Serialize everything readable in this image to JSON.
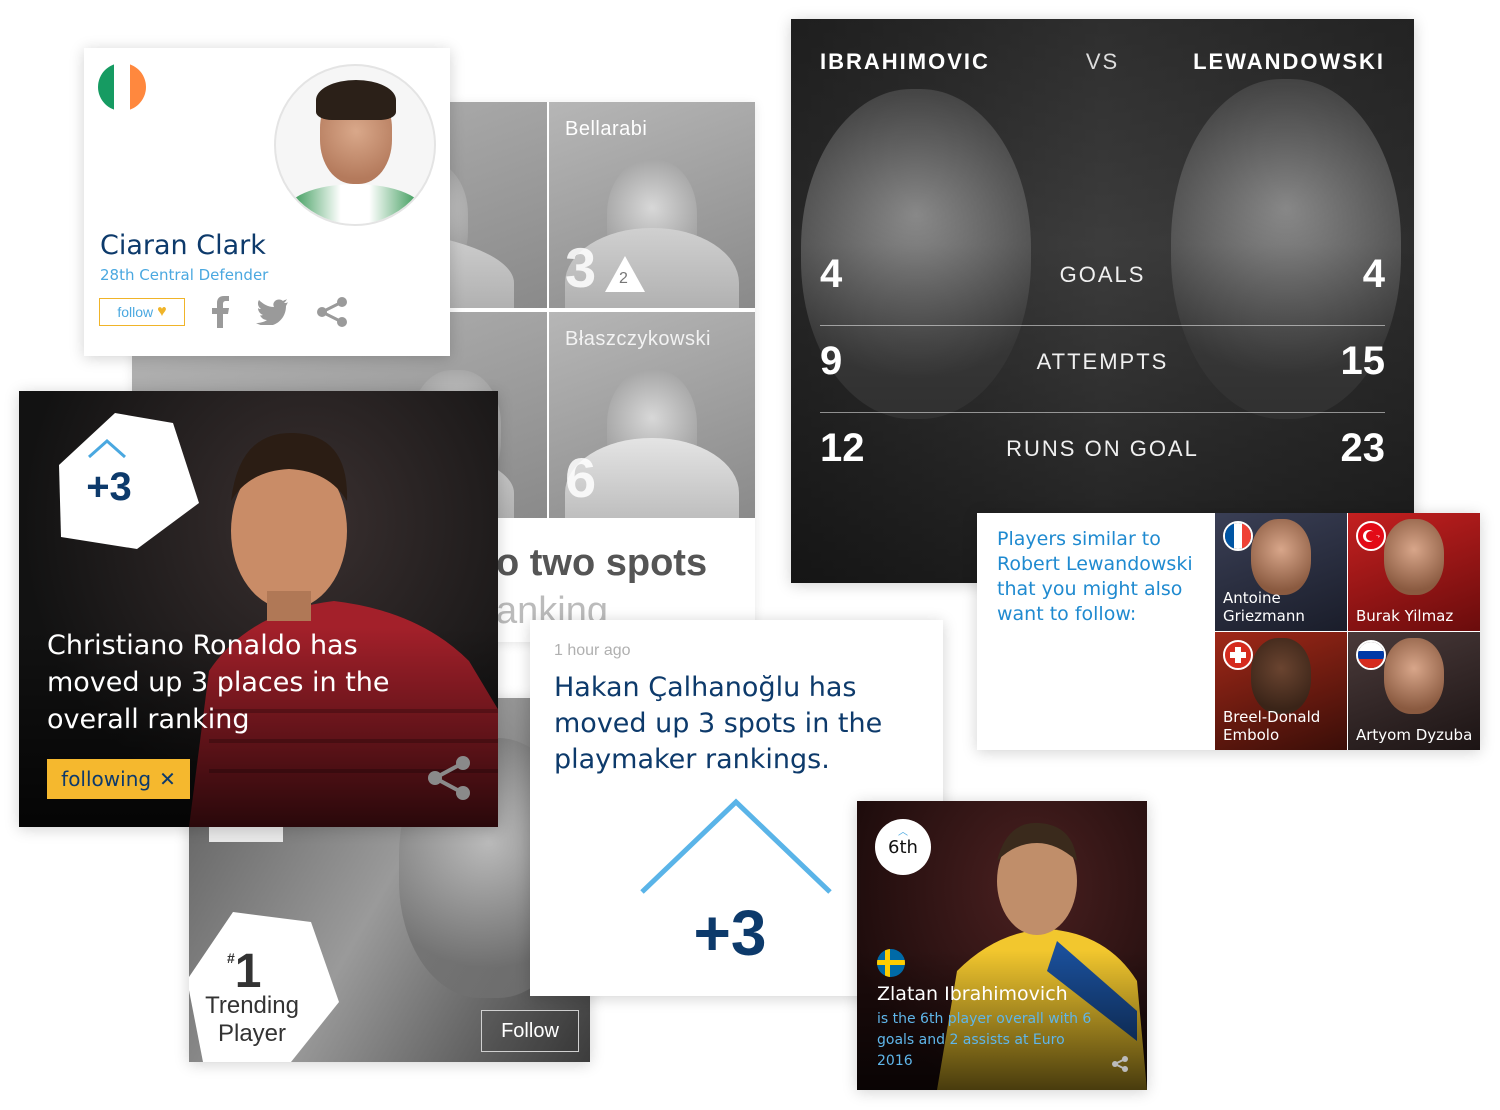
{
  "grid": {
    "tiles": [
      {
        "name": "",
        "rank": ""
      },
      {
        "name": "Bellarabi",
        "rank": "3",
        "move": "2"
      },
      {
        "name": "",
        "rank": ""
      },
      {
        "name": "Błaszczykowski",
        "rank": "6"
      }
    ],
    "headline_partial": "o two spots",
    "sub_partial": "anking"
  },
  "ciaran": {
    "name": "Ciaran Clark",
    "position": "28th Central Defender",
    "follow_label": "follow",
    "flag": [
      "#169b62",
      "#ffffff",
      "#ff883e"
    ],
    "icons": [
      "facebook-icon",
      "twitter-icon",
      "share-icon"
    ]
  },
  "ronaldo": {
    "move": "+3",
    "headline": "Christiano Ronaldo has moved up 3 places in the overall ranking",
    "following_label": "following",
    "close_glyph": "✕"
  },
  "trending": {
    "rank_prefix": "#",
    "rank": "1",
    "label": "Trending Player",
    "follow_label": "Follow"
  },
  "hakan": {
    "time": "1 hour ago",
    "headline": "Hakan Çalhanoğlu has moved up 3 spots in the playmaker rankings.",
    "move": "+3"
  },
  "vs": {
    "left_player": "IBRAHIMOVIC",
    "label": "VS",
    "right_player": "LEWANDOWSKI",
    "rows": [
      {
        "left": "4",
        "stat": "GOALS",
        "right": "4"
      },
      {
        "left": "9",
        "stat": "ATTEMPTS",
        "right": "15"
      },
      {
        "left": "12",
        "stat": "RUNS ON GOAL",
        "right": "23"
      }
    ]
  },
  "similar": {
    "intro": "Players similar to Robert Lewandowski that you might also want to follow:",
    "players": [
      {
        "name": "Antoine Griezmann",
        "country": "France"
      },
      {
        "name": "Burak Yilmaz",
        "country": "Turkey"
      },
      {
        "name": "Breel-Donald Embolo",
        "country": "Switzerland"
      },
      {
        "name": "Artyom Dyzuba",
        "country": "Russia"
      }
    ]
  },
  "zlatan": {
    "rank": "6th",
    "name": "Zlatan Ibrahimovich",
    "description": "is the 6th player overall with 6 goals and 2 assists at Euro 2016",
    "flag": [
      "#006aa7",
      "#fecc00"
    ]
  },
  "colors": {
    "navy": "#0d3a6b",
    "accent_blue": "#4aa8e0",
    "accent_yellow": "#f5b82e"
  }
}
